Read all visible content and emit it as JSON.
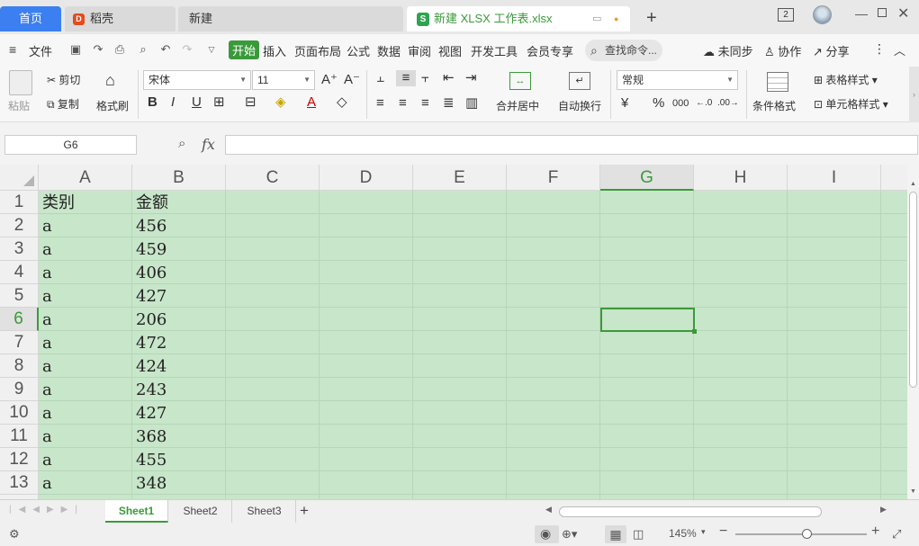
{
  "tabs": {
    "home": "首页",
    "docer": "稻壳",
    "new": "新建",
    "active_doc": "新建 XLSX 工作表.xlsx",
    "add": "+"
  },
  "window": {
    "badge": "2"
  },
  "menu": {
    "file": "文件",
    "items": [
      "开始",
      "插入",
      "页面布局",
      "公式",
      "数据",
      "审阅",
      "视图",
      "开发工具",
      "会员专享"
    ],
    "search": "查找命令...",
    "sync": "未同步",
    "collab": "协作",
    "share": "分享"
  },
  "ribbon": {
    "paste": "粘贴",
    "cut": "剪切",
    "copy": "复制",
    "format_painter": "格式刷",
    "font_name": "宋体",
    "font_size": "11",
    "merge": "合并居中",
    "wrap": "自动换行",
    "number_format": "常规",
    "conditional": "条件格式",
    "table_style": "表格样式",
    "cell_style": "单元格样式"
  },
  "formula": {
    "namebox": "G6",
    "fx": "fx"
  },
  "sheet": {
    "columns": [
      "A",
      "B",
      "C",
      "D",
      "E",
      "F",
      "G",
      "H",
      "I"
    ],
    "selected_column": "G",
    "rows": [
      "1",
      "2",
      "3",
      "4",
      "5",
      "6",
      "7",
      "8",
      "9",
      "10",
      "11",
      "12",
      "13"
    ],
    "selected_row": "6",
    "cells": [
      [
        "类别",
        "金额"
      ],
      [
        "a",
        "456"
      ],
      [
        "a",
        "459"
      ],
      [
        "a",
        "406"
      ],
      [
        "a",
        "427"
      ],
      [
        "a",
        "206"
      ],
      [
        "a",
        "472"
      ],
      [
        "a",
        "424"
      ],
      [
        "a",
        "243"
      ],
      [
        "a",
        "427"
      ],
      [
        "a",
        "368"
      ],
      [
        "a",
        "455"
      ],
      [
        "a",
        "348"
      ]
    ]
  },
  "sheets": [
    "Sheet1",
    "Sheet2",
    "Sheet3"
  ],
  "status": {
    "zoom": "145%"
  }
}
